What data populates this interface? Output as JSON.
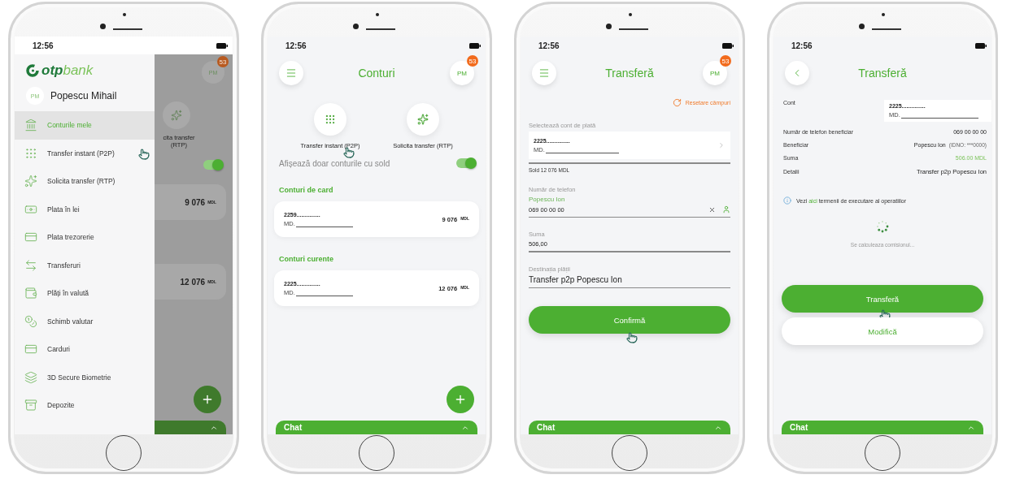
{
  "phones": [
    {
      "kind": "menu",
      "time": "12:56",
      "brand_lead": "otp",
      "brand_trail": "bank",
      "user": {
        "initials": "PM",
        "name": "Popescu Mihail"
      },
      "menu": [
        {
          "label": "Conturile mele",
          "selected": true,
          "cursor": false
        },
        {
          "label": "Transfer instant (P2P)",
          "selected": false,
          "cursor": true
        },
        {
          "label": "Solicita transfer (RTP)",
          "selected": false,
          "cursor": false
        },
        {
          "label": "Plata în lei",
          "selected": false,
          "cursor": false
        },
        {
          "label": "Plata trezorerie",
          "selected": false,
          "cursor": false
        },
        {
          "label": "Transferuri",
          "selected": false,
          "cursor": false
        },
        {
          "label": "Plăți în valută",
          "selected": false,
          "cursor": false
        },
        {
          "label": "Schimb valutar",
          "selected": false,
          "cursor": false
        },
        {
          "label": "Carduri",
          "selected": false,
          "cursor": false
        },
        {
          "label": "3D Secure Biometrie",
          "selected": false,
          "cursor": false
        },
        {
          "label": "Depozite",
          "selected": false,
          "cursor": false
        }
      ],
      "backdrop": {
        "initials": "PM",
        "badge": "53",
        "action_label": "cita transfer (RTP)",
        "toggle_on": true,
        "balances": [
          {
            "amount": "9 076",
            "currency": "MDL"
          },
          {
            "amount": "12 076",
            "currency": "MDL"
          }
        ]
      }
    },
    {
      "kind": "accounts",
      "time": "12:56",
      "header": {
        "title": "Conturi",
        "initials": "PM",
        "badge": "53"
      },
      "quick_actions": [
        {
          "label": "Transfer instant (P2P)",
          "cursor": true
        },
        {
          "label": "Solicita transfer (RTP)",
          "cursor": false
        }
      ],
      "toggle": {
        "label": "Afișează doar conturile cu sold",
        "on": true
      },
      "sections": [
        {
          "title": "Conturi de card",
          "accounts": [
            {
              "number": "2259...............",
              "iban": "MD.",
              "amount": "9 076",
              "currency": "MDL"
            }
          ]
        },
        {
          "title": "Conturi curente",
          "accounts": [
            {
              "number": "2225...............",
              "iban": "MD.",
              "amount": "12 076",
              "currency": "MDL"
            }
          ]
        }
      ],
      "chat": "Chat"
    },
    {
      "kind": "form",
      "time": "12:56",
      "header": {
        "title": "Transferă",
        "initials": "PM",
        "badge": "53"
      },
      "reset": "Resetare câmpuri",
      "fields": [
        {
          "kind": "account",
          "label": "Selectează cont de plată",
          "number": "2225...............",
          "iban": "MD.",
          "note": "Sold 12 076 MDL"
        },
        {
          "kind": "phone",
          "label": "Număr de telefon",
          "name": "Popescu Ion",
          "value": "069 00 00 00"
        },
        {
          "kind": "text",
          "label": "Suma",
          "value": "506,00"
        },
        {
          "kind": "large",
          "label": "Destinația plății",
          "value": "Transfer p2p Popescu Ion"
        }
      ],
      "buttons": [
        {
          "label": "Confirmă",
          "kind": "primary",
          "cursor": true
        }
      ],
      "chat": "Chat"
    },
    {
      "kind": "review",
      "time": "12:56",
      "header": {
        "title": "Transferă"
      },
      "rows": [
        {
          "kind": "account",
          "label": "Cont",
          "number": "2225...............",
          "iban": "MD."
        },
        {
          "kind": "small",
          "label": "Număr de telefon beneficiar",
          "value": "069 00 00 00"
        },
        {
          "kind": "beneficiary",
          "label": "Beneficiar",
          "value": "Popescu Ion",
          "note": "(IDNO: ***0000)"
        },
        {
          "kind": "amount",
          "label": "Suma",
          "value": "506.00 MDL"
        },
        {
          "kind": "plain",
          "label": "Detalii",
          "value": "Transfer p2p Popescu Ion"
        }
      ],
      "info": {
        "lead": "Vezi",
        "link": "aici",
        "tail": "termenii de executare al operatiilor"
      },
      "status": "Se calculeaza comisionul...",
      "buttons": [
        {
          "label": "Transferă",
          "kind": "primary",
          "cursor": true
        },
        {
          "label": "Modifică",
          "kind": "secondary",
          "cursor": false
        }
      ],
      "chat": "Chat"
    }
  ]
}
